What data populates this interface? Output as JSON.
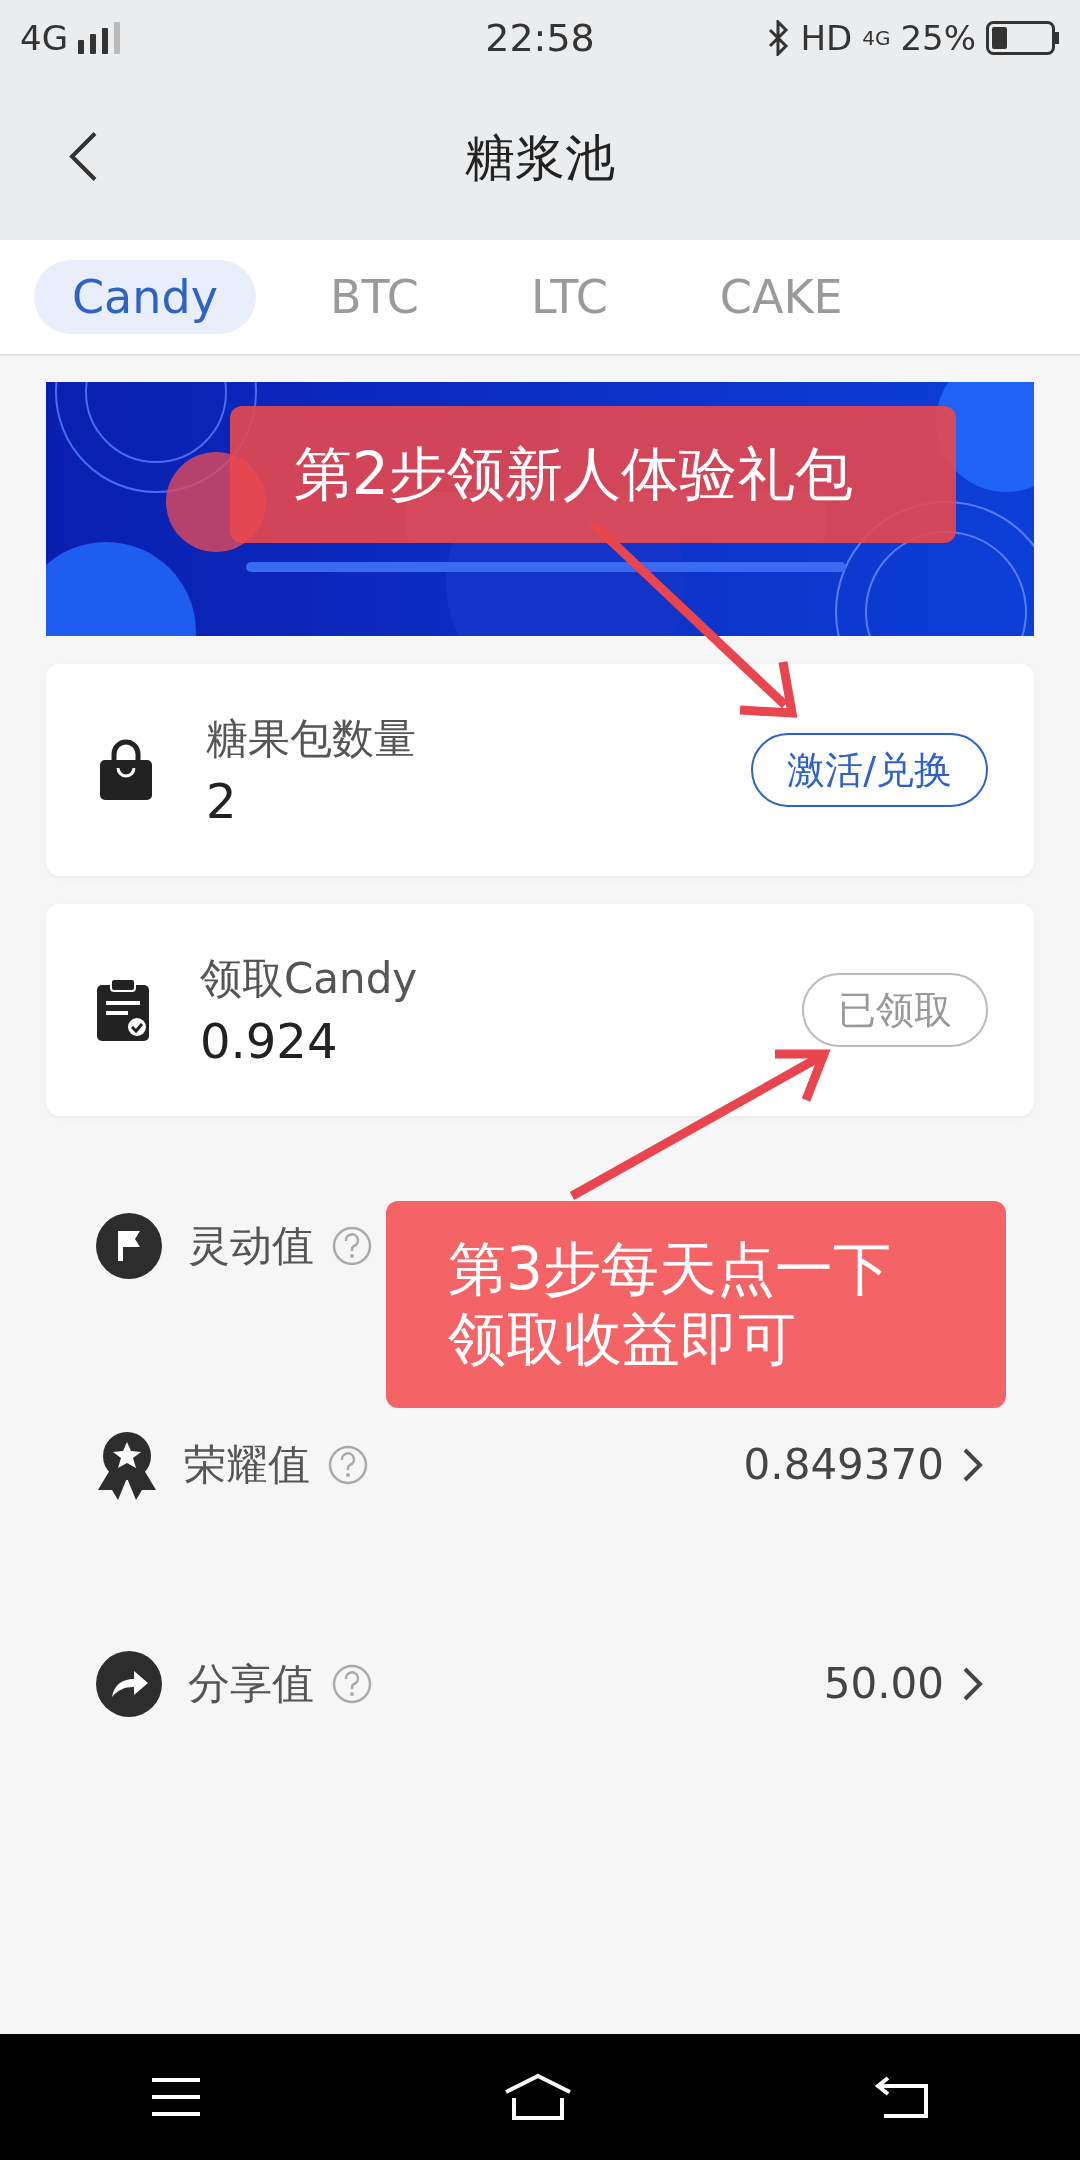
{
  "status_bar": {
    "network": "4G",
    "time": "22:58",
    "hd": "HD",
    "data": "4G",
    "battery": "25%"
  },
  "header": {
    "title": "糖浆池"
  },
  "tabs": [
    {
      "label": "Candy",
      "selected": true
    },
    {
      "label": "BTC",
      "selected": false
    },
    {
      "label": "LTC",
      "selected": false
    },
    {
      "label": "CAKE",
      "selected": false
    }
  ],
  "cards": [
    {
      "kind": "bag",
      "label": "糖果包数量",
      "value": "2",
      "button": {
        "label": "激活/兑换",
        "disabled": false
      }
    },
    {
      "kind": "clipboard",
      "label": "领取Candy",
      "value": "0.924",
      "button": {
        "label": "已领取",
        "disabled": true
      }
    }
  ],
  "stats": [
    {
      "kind": "flag",
      "label": "灵动值"
    },
    {
      "kind": "medal",
      "label": "荣耀值",
      "value": "0.849370"
    },
    {
      "kind": "share",
      "label": "分享值",
      "value": "50.00"
    }
  ],
  "annotations": [
    {
      "lines": [
        "第2步领新人体验礼包"
      ]
    },
    {
      "lines": [
        "第3步每天点一下",
        "领取收益即可"
      ]
    }
  ]
}
